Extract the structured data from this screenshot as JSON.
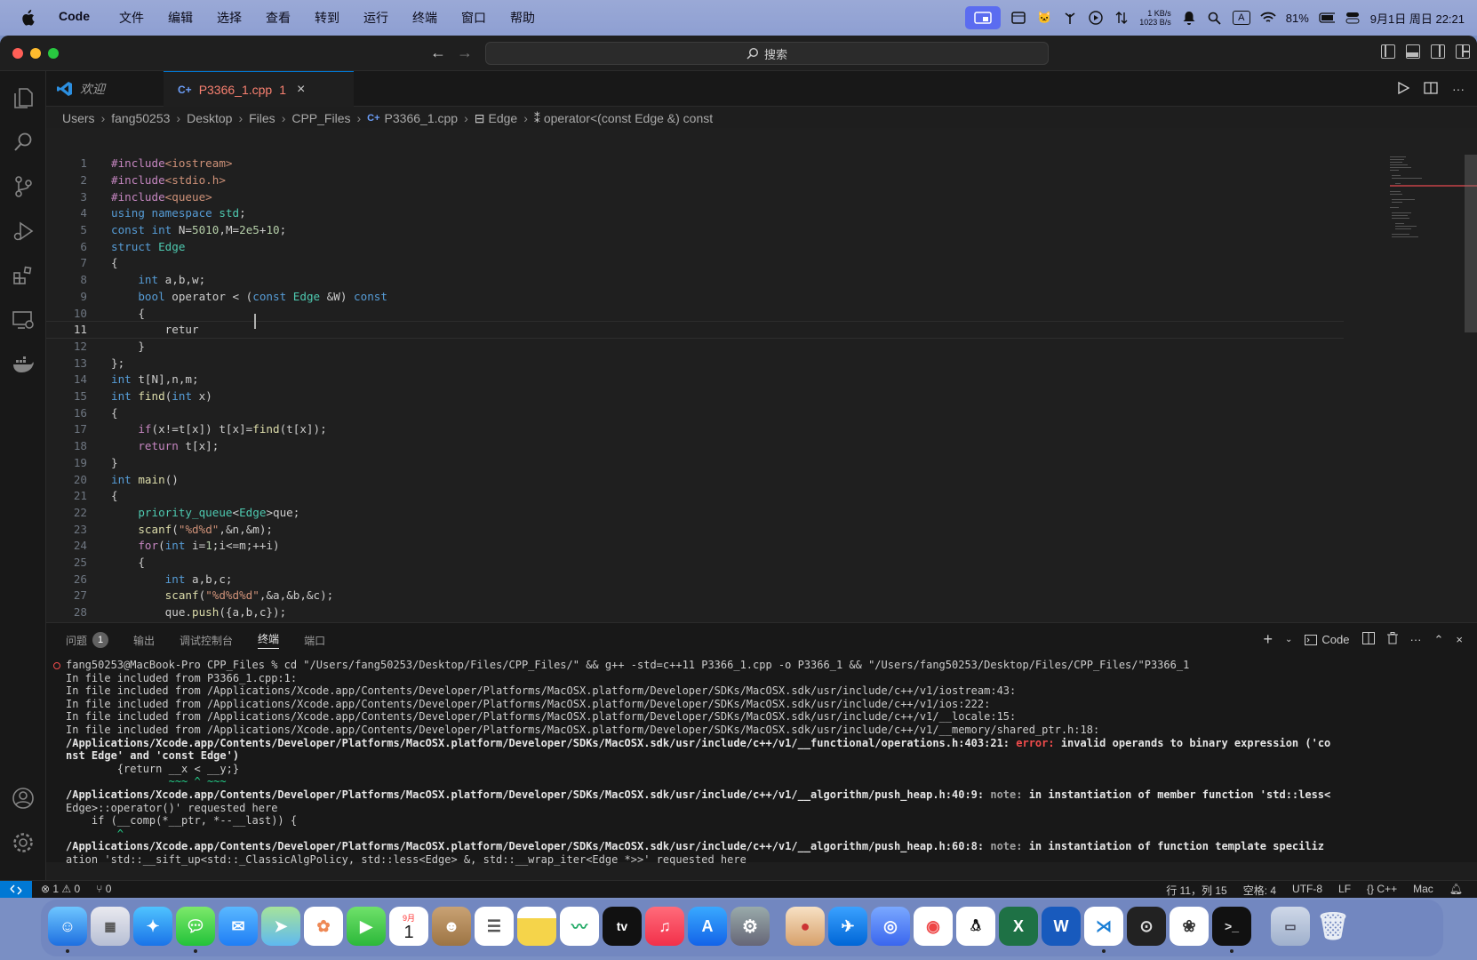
{
  "menubar": {
    "app_name": "Code",
    "items": [
      "文件",
      "编辑",
      "选择",
      "查看",
      "转到",
      "运行",
      "终端",
      "窗口",
      "帮助"
    ],
    "net_up": "1 KB/s",
    "net_down": "1023 B/s",
    "input_method": "A",
    "battery": "81%",
    "datetime": "9月1日 周日  22:21"
  },
  "titlebar": {
    "search_placeholder": "搜索"
  },
  "tabs": [
    {
      "label": "欢迎",
      "icon": "vscode-icon"
    },
    {
      "label": "P3366_1.cpp",
      "problems": "1",
      "icon": "cpp-file-icon"
    }
  ],
  "breadcrumb": [
    "Users",
    "fang50253",
    "Desktop",
    "Files",
    "CPP_Files",
    "P3366_1.cpp",
    "Edge",
    "operator<(const Edge &) const"
  ],
  "editor": {
    "lines": [
      {
        "n": "1",
        "code": "#include<iostream>"
      },
      {
        "n": "2",
        "code": "#include<stdio.h>"
      },
      {
        "n": "3",
        "code": "#include<queue>"
      },
      {
        "n": "4",
        "code": "using namespace std;"
      },
      {
        "n": "5",
        "code": "const int N=5010,M=2e5+10;"
      },
      {
        "n": "6",
        "code": "struct Edge"
      },
      {
        "n": "7",
        "code": "{"
      },
      {
        "n": "8",
        "code": "    int a,b,w;"
      },
      {
        "n": "9",
        "code": "    bool operator < (const Edge &W) const"
      },
      {
        "n": "10",
        "code": "    {"
      },
      {
        "n": "11",
        "code": "        retur "
      },
      {
        "n": "12",
        "code": "    }"
      },
      {
        "n": "13",
        "code": "};"
      },
      {
        "n": "14",
        "code": "int t[N],n,m;"
      },
      {
        "n": "15",
        "code": "int find(int x)"
      },
      {
        "n": "16",
        "code": "{"
      },
      {
        "n": "17",
        "code": "    if(x!=t[x]) t[x]=find(t[x]);"
      },
      {
        "n": "18",
        "code": "    return t[x];"
      },
      {
        "n": "19",
        "code": "}"
      },
      {
        "n": "20",
        "code": "int main()"
      },
      {
        "n": "21",
        "code": "{"
      },
      {
        "n": "22",
        "code": "    priority_queue<Edge>que;"
      },
      {
        "n": "23",
        "code": "    scanf(\"%d%d\",&n,&m);"
      },
      {
        "n": "24",
        "code": "    for(int i=1;i<=m;++i)"
      },
      {
        "n": "25",
        "code": "    {"
      },
      {
        "n": "26",
        "code": "        int a,b,c;"
      },
      {
        "n": "27",
        "code": "        scanf(\"%d%d%d\",&a,&b,&c);"
      },
      {
        "n": "28",
        "code": "        que.push({a,b,c});"
      }
    ]
  },
  "panel": {
    "tabs": [
      "问题",
      "输出",
      "调试控制台",
      "终端",
      "端口"
    ],
    "problems_count": "1",
    "terminal_profile": "Code",
    "terminal_lines": [
      "fang50253@MacBook-Pro CPP_Files % cd \"/Users/fang50253/Desktop/Files/CPP_Files/\" && g++ -std=c++11 P3366_1.cpp -o P3366_1 && \"/Users/fang50253/Desktop/Files/CPP_Files/\"P3366_1",
      "In file included from P3366_1.cpp:1:",
      "In file included from /Applications/Xcode.app/Contents/Developer/Platforms/MacOSX.platform/Developer/SDKs/MacOSX.sdk/usr/include/c++/v1/iostream:43:",
      "In file included from /Applications/Xcode.app/Contents/Developer/Platforms/MacOSX.platform/Developer/SDKs/MacOSX.sdk/usr/include/c++/v1/ios:222:",
      "In file included from /Applications/Xcode.app/Contents/Developer/Platforms/MacOSX.platform/Developer/SDKs/MacOSX.sdk/usr/include/c++/v1/__locale:15:",
      "In file included from /Applications/Xcode.app/Contents/Developer/Platforms/MacOSX.platform/Developer/SDKs/MacOSX.sdk/usr/include/c++/v1/__memory/shared_ptr.h:18:"
    ],
    "error_path": "/Applications/Xcode.app/Contents/Developer/Platforms/MacOSX.platform/Developer/SDKs/MacOSX.sdk/usr/include/c++/v1/__functional/operations.h:403:21: ",
    "error_label": "error: ",
    "error_msg": "invalid operands to binary expression ('co",
    "error_msg2": "nst Edge' and 'const Edge')",
    "error_src": "        {return __x < __y;}",
    "error_marker": "                ~~~ ^ ~~~",
    "note1_path": "/Applications/Xcode.app/Contents/Developer/Platforms/MacOSX.platform/Developer/SDKs/MacOSX.sdk/usr/include/c++/v1/__algorithm/push_heap.h:40:9: ",
    "note_label": "note: ",
    "note1_msg": "in instantiation of member function 'std::less<",
    "note1_msg2": "Edge>::operator()' requested here",
    "note1_src": "    if (__comp(*__ptr, *--__last)) {",
    "note1_marker": "        ^",
    "note2_path": "/Applications/Xcode.app/Contents/Developer/Platforms/MacOSX.platform/Developer/SDKs/MacOSX.sdk/usr/include/c++/v1/__algorithm/push_heap.h:60:8: ",
    "note2_msg": "in instantiation of function template speciliz",
    "note2_msg2": "ation 'std::__sift_up<std::_ClassicAlgPolicy, std::less<Edge> &, std::__wrap_iter<Edge *>>' requested here"
  },
  "statusbar": {
    "errors": "1",
    "warnings": "0",
    "ports": "0",
    "position": "行 11，列 15",
    "spaces": "空格: 4",
    "encoding": "UTF-8",
    "eol": "LF",
    "language": "C++",
    "platform": "Mac"
  },
  "dock": {
    "calendar_month": "9月",
    "calendar_day": "1",
    "tv_label": "tv"
  }
}
